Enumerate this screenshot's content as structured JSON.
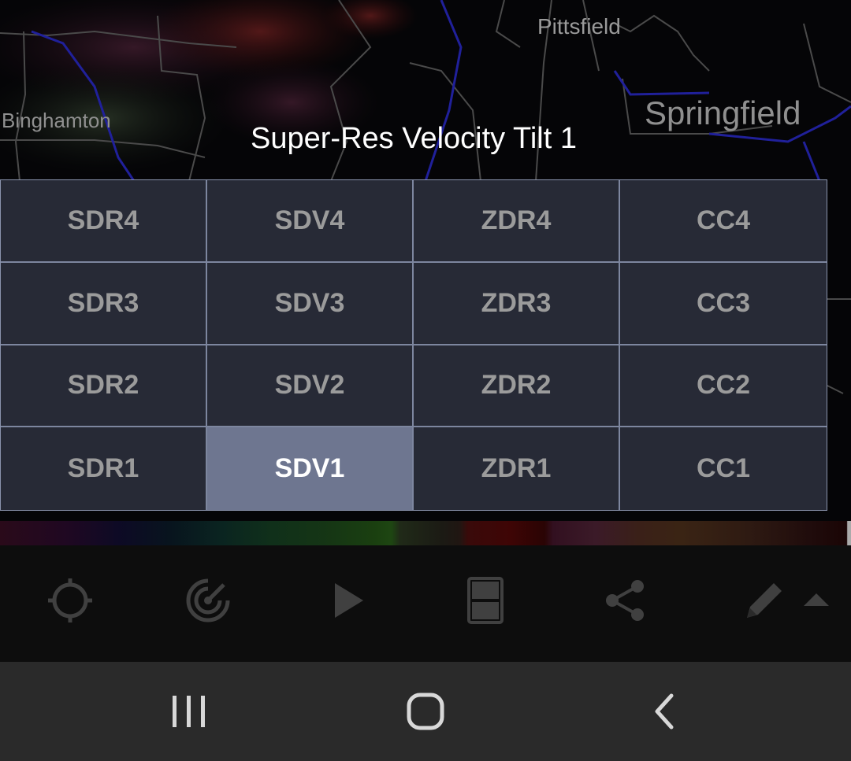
{
  "map": {
    "cities": {
      "pittsfield": "Pittsfield",
      "binghamton": "Binghamton",
      "springfield": "Springfield"
    }
  },
  "dialog": {
    "title": "Super-Res Velocity Tilt 1",
    "selected": "SDV1",
    "rows": [
      [
        "SDR4",
        "SDV4",
        "ZDR4",
        "CC4"
      ],
      [
        "SDR3",
        "SDV3",
        "ZDR3",
        "CC3"
      ],
      [
        "SDR2",
        "SDV2",
        "ZDR2",
        "CC2"
      ],
      [
        "SDR1",
        "SDV1",
        "ZDR1",
        "CC1"
      ]
    ]
  },
  "toolbar": {
    "icons": [
      "crosshair-icon",
      "radar-icon",
      "play-icon",
      "split-layout-icon",
      "share-icon",
      "pencil-icon",
      "triangle-up-icon"
    ],
    "icon_color": "#404040"
  },
  "nav": {
    "icons": [
      "recents-icon",
      "home-icon",
      "back-icon"
    ],
    "icon_color": "#d8d8d8"
  },
  "colors": {
    "grid_bg": "#272a36",
    "grid_border": "#7d869f",
    "selected_bg": "#6e7690",
    "label": "#9b9b9b",
    "selected_label": "#ffffff"
  }
}
